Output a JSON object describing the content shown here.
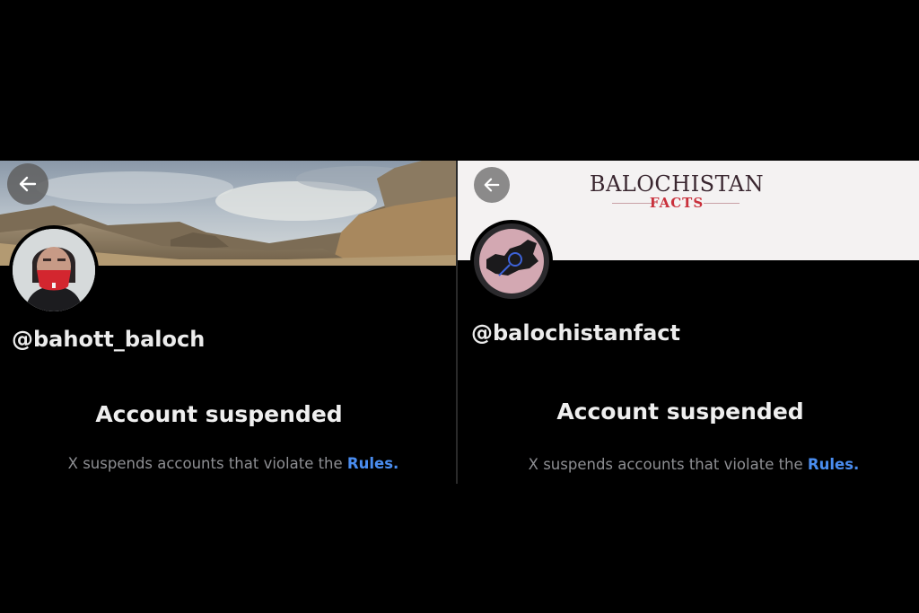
{
  "left_profile": {
    "handle": "@bahott_baloch",
    "title": "Account suspended",
    "message": "X suspends accounts that violate the",
    "rules_link": "Rules",
    "period": ".",
    "back_icon": "arrow-left-icon"
  },
  "right_profile": {
    "brand_line1": "BALOCHISTAN",
    "brand_line2": "FACTS",
    "handle": "@balochistanfact",
    "title": "Account suspended",
    "message": "X suspends accounts that violate the",
    "rules_link": "Rules",
    "period": ".",
    "back_icon": "arrow-left-icon"
  },
  "colors": {
    "background": "#000000",
    "link": "#4a8df0",
    "title_text": "#efefef",
    "muted_text": "#8e8f93"
  }
}
